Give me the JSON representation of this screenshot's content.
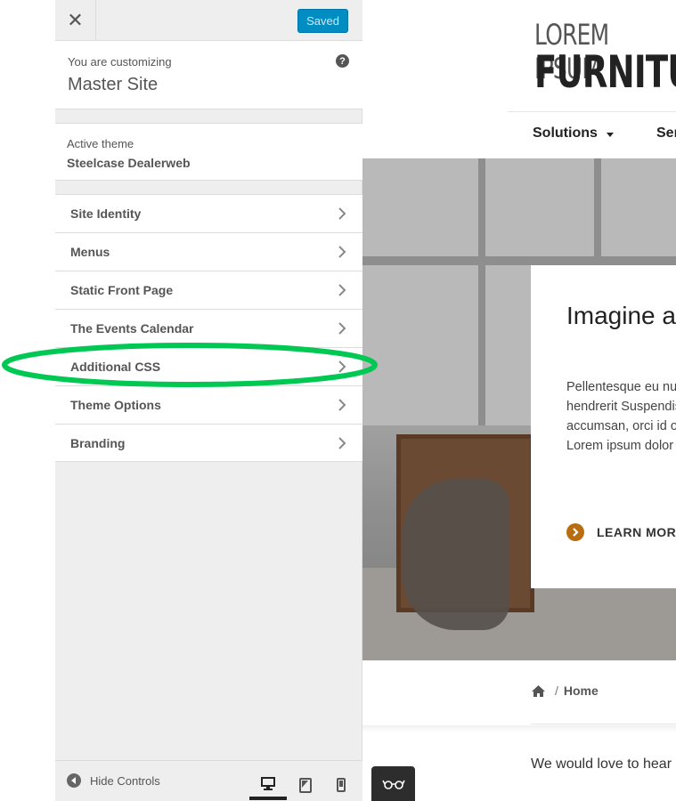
{
  "customizer": {
    "close_label": "✕",
    "saved_label": "Saved",
    "customizing_label": "You are customizing",
    "site_name": "Master Site",
    "active_theme_label": "Active theme",
    "theme_name": "Steelcase Dealerweb",
    "sections": [
      "Site Identity",
      "Menus",
      "Static Front Page",
      "The Events Calendar",
      "Additional CSS",
      "Theme Options",
      "Branding"
    ],
    "hide_controls_label": "Hide Controls",
    "devices": [
      "desktop-icon",
      "tablet-icon",
      "mobile-icon"
    ]
  },
  "preview": {
    "logo_line1": "LOREM IPSUM",
    "logo_line2": "FURNITURE",
    "nav": {
      "solutions": "Solutions",
      "services": "Services"
    },
    "hero": {
      "title": "Imagine a place",
      "body": "Pellentesque eu nunc bibendum ac hendrerit Suspendisse sed sem accumsan, orci id orci laoreet elit, at Lorem ipsum dolor sit adipiscing elit.",
      "cta": "LEARN MORE"
    },
    "breadcrumb": {
      "home": "Home",
      "separator": "/"
    },
    "intro": "We would love to hear"
  },
  "colors": {
    "accent_blue": "#008ec2",
    "highlight_green": "#00c853",
    "cta_orange": "#b86e10"
  }
}
